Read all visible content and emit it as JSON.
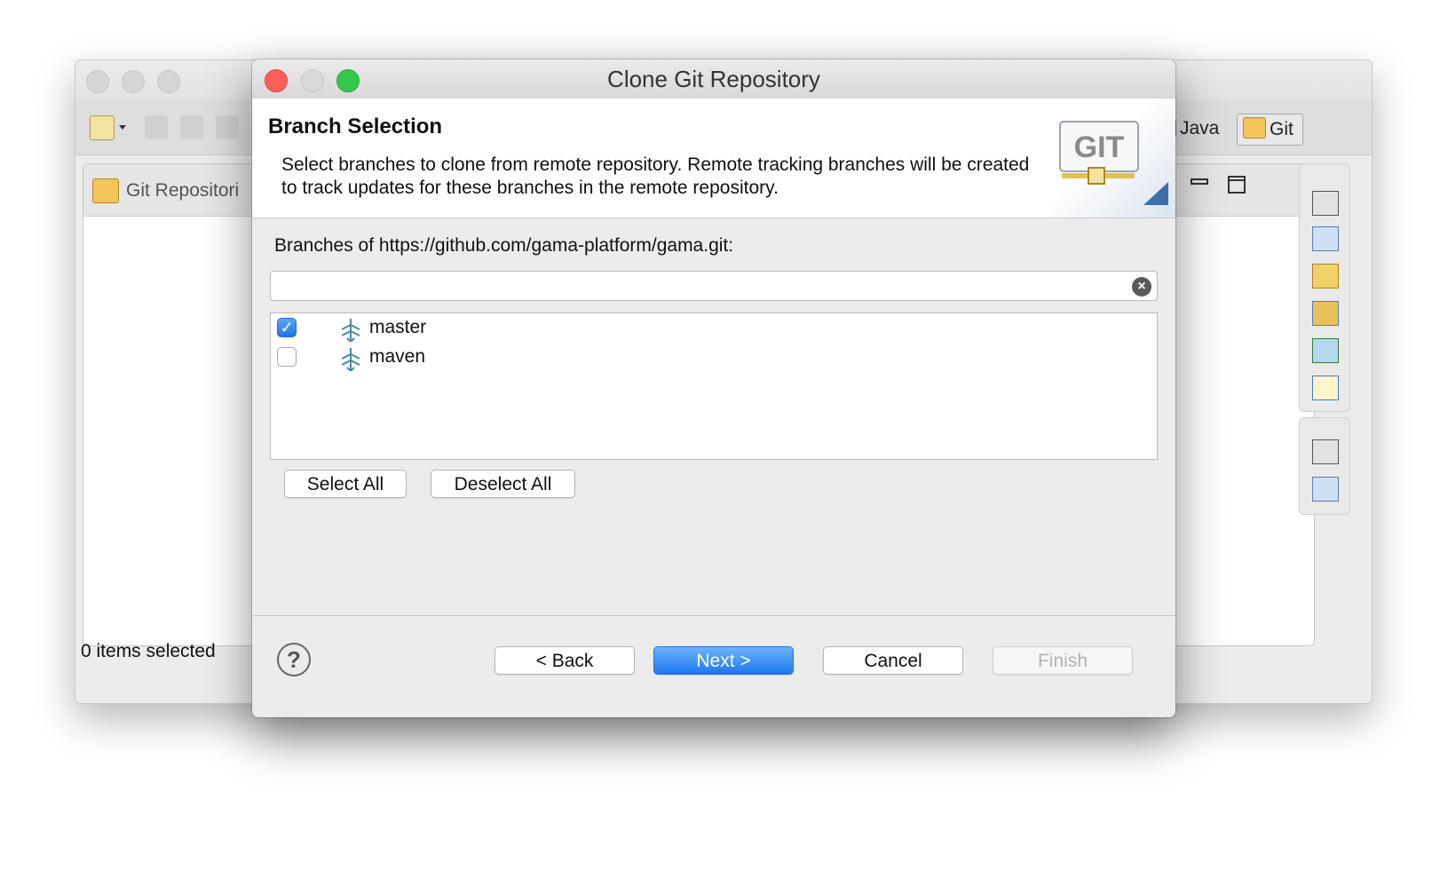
{
  "background_window": {
    "view_title": "Git Repositori",
    "status": "0 items selected",
    "perspectives": [
      {
        "label": "Java",
        "icon": "java-perspective-icon"
      },
      {
        "label": "Git",
        "icon": "git-perspective-icon"
      }
    ]
  },
  "dialog": {
    "title": "Clone Git Repository",
    "header": {
      "title": "Branch Selection",
      "description": "Select branches to clone from remote repository. Remote tracking branches will be created to track updates for these branches in the remote repository.",
      "logo_text": "GIT"
    },
    "branches_label": "Branches of https://github.com/gama-platform/gama.git:",
    "filter": {
      "value": "",
      "placeholder": ""
    },
    "branches": [
      {
        "name": "master",
        "checked": true
      },
      {
        "name": "maven",
        "checked": false
      }
    ],
    "buttons": {
      "select_all": "Select All",
      "deselect_all": "Deselect All",
      "back": "< Back",
      "next": "Next >",
      "cancel": "Cancel",
      "finish": "Finish"
    },
    "help_symbol": "?"
  }
}
